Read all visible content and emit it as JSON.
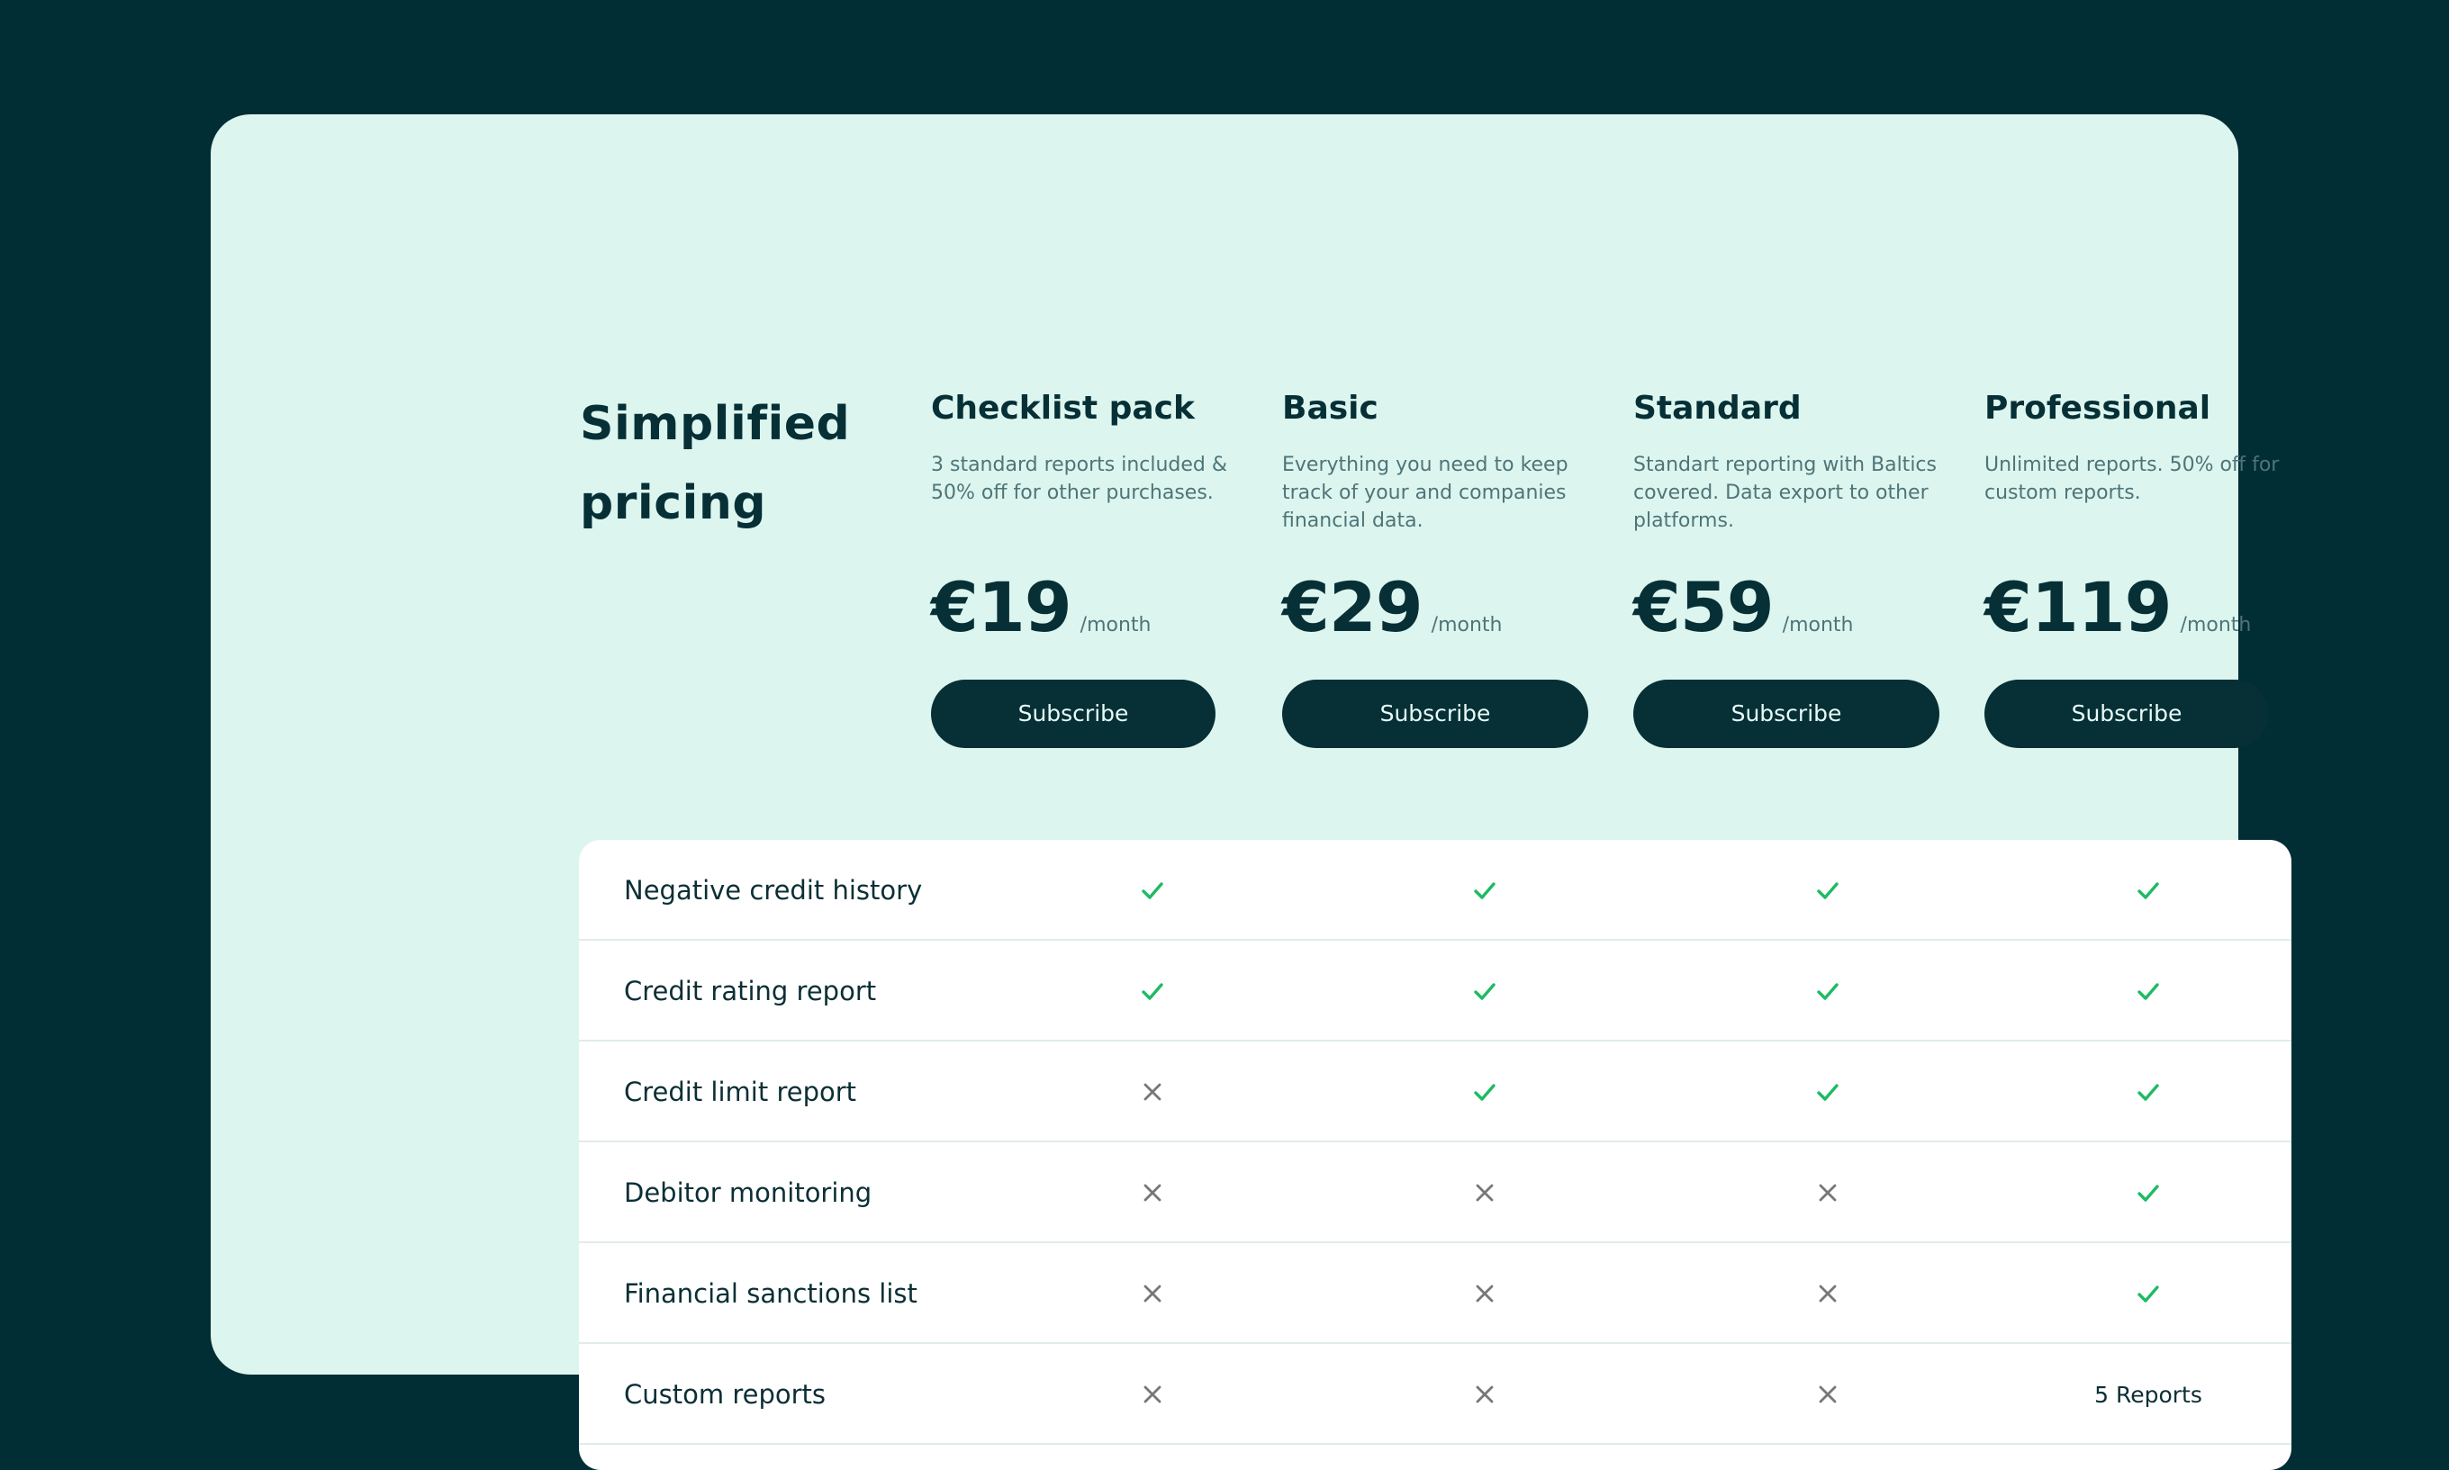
{
  "page": {
    "heading": "Simplified pricing"
  },
  "plans": [
    {
      "name": "Checklist pack",
      "description": "3 standard reports included & 50% off for other purchases.",
      "price": "€19",
      "period": "/month",
      "cta": "Subscribe"
    },
    {
      "name": "Basic",
      "description": "Everything you need to keep track of your and companies financial data.",
      "price": "€29",
      "period": "/month",
      "cta": "Subscribe"
    },
    {
      "name": "Standard",
      "description": "Standart reporting with Baltics covered. Data export to other platforms.",
      "price": "€59",
      "period": "/month",
      "cta": "Subscribe"
    },
    {
      "name": "Professional",
      "description": "Unlimited reports. 50% off for custom reports.",
      "price": "€119",
      "period": "/month",
      "cta": "Subscribe"
    }
  ],
  "features": [
    {
      "label": "Negative credit history",
      "cells": [
        {
          "type": "check"
        },
        {
          "type": "check"
        },
        {
          "type": "check"
        },
        {
          "type": "check"
        }
      ]
    },
    {
      "label": "Credit rating report",
      "cells": [
        {
          "type": "check"
        },
        {
          "type": "check"
        },
        {
          "type": "check"
        },
        {
          "type": "check"
        }
      ]
    },
    {
      "label": "Credit limit report",
      "cells": [
        {
          "type": "cross"
        },
        {
          "type": "check"
        },
        {
          "type": "check"
        },
        {
          "type": "check"
        }
      ]
    },
    {
      "label": "Debitor monitoring",
      "cells": [
        {
          "type": "cross"
        },
        {
          "type": "cross"
        },
        {
          "type": "cross"
        },
        {
          "type": "check"
        }
      ]
    },
    {
      "label": "Financial sanctions list",
      "cells": [
        {
          "type": "cross"
        },
        {
          "type": "cross"
        },
        {
          "type": "cross"
        },
        {
          "type": "check"
        }
      ]
    },
    {
      "label": "Custom reports",
      "cells": [
        {
          "type": "cross"
        },
        {
          "type": "cross"
        },
        {
          "type": "cross"
        },
        {
          "type": "text",
          "text": "5 Reports"
        }
      ]
    }
  ],
  "icons": {
    "check": "check-icon",
    "cross": "close-icon"
  },
  "colors": {
    "background": "#012d34",
    "card": "#dcf6ef",
    "primary": "#062f36",
    "muted_text": "#4f7478",
    "check": "#1dbb63",
    "cross": "#777777",
    "table": "#ffffff"
  }
}
